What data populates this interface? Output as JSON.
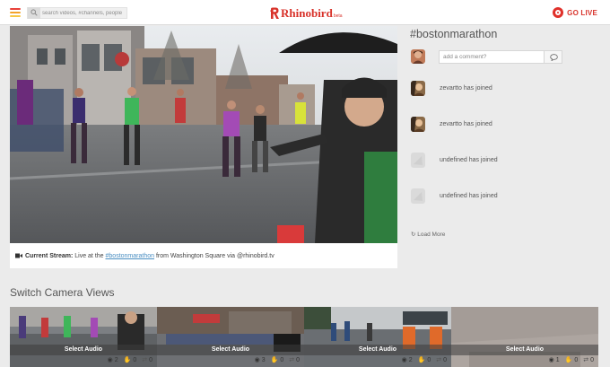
{
  "header": {
    "search_placeholder": "search videos, #channels, people",
    "logo_text": "Rhinobird",
    "logo_beta": "beta",
    "go_live_label": "GO LIVE",
    "menu_colors": [
      "#e8413a",
      "#f3a32a",
      "#f7c744"
    ]
  },
  "stream": {
    "caption_label": "Current Stream:",
    "caption_pre": "Live at the",
    "caption_tag": "#bostonmarathon",
    "caption_post": "from Washington Square via @rhinobird.tv"
  },
  "sidebar": {
    "hashtag": "#bostonmarathon",
    "comment_placeholder": "add a comment?",
    "feed": [
      {
        "text": "zevartto has joined",
        "avatar": "photo"
      },
      {
        "text": "zevartto has joined",
        "avatar": "photo"
      },
      {
        "text": "undefined has joined",
        "avatar": "blank"
      },
      {
        "text": "undefined has joined",
        "avatar": "blank"
      }
    ],
    "load_more": "Load More"
  },
  "cameras": {
    "title": "Switch Camera Views",
    "items": [
      {
        "label": "Select Audio",
        "views": "2",
        "likes": "0",
        "shares": "0"
      },
      {
        "label": "Select Audio",
        "views": "3",
        "likes": "0",
        "shares": "0"
      },
      {
        "label": "Select Audio",
        "views": "2",
        "likes": "0",
        "shares": "0"
      },
      {
        "label": "Select Audio",
        "views": "1",
        "likes": "0",
        "shares": "0"
      }
    ]
  },
  "colors": {
    "brand_red": "#d8322a",
    "link_blue": "#4a8ec2"
  }
}
